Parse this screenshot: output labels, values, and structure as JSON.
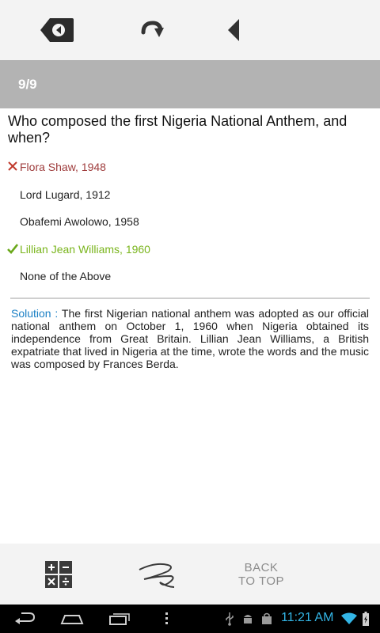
{
  "toolbar": {
    "erase_icon": "backspace-icon",
    "redo_icon": "redo-arrow-icon",
    "back_icon": "triangle-left-icon"
  },
  "progress": {
    "text": "9/9"
  },
  "question": {
    "text": "Who composed the first Nigeria National Anthem, and when?"
  },
  "options": [
    {
      "label": "Flora Shaw, 1948",
      "state": "wrong",
      "color": "#9e3b3b"
    },
    {
      "label": "Lord Lugard, 1912",
      "state": "none"
    },
    {
      "label": "Obafemi Awolowo, 1958",
      "state": "none"
    },
    {
      "label": "Lillian Jean Williams, 1960",
      "state": "correct",
      "color": "#7ab51d"
    },
    {
      "label": "None of the Above",
      "state": "none"
    }
  ],
  "solution": {
    "label": "Solution :",
    "text": "The first Nigerian national anthem was adopted as our official national anthem on October 1, 1960 when Nigeria obtained its independence from Great Britain. Lillian Jean Williams, a British expatriate that lived in Nigeria at the time, wrote the words and the music was composed by Frances Berda.",
    "label_color": "#1a7fc4"
  },
  "bottom_bar": {
    "calc_icon": "calculator-icon",
    "draw_icon": "scribble-icon",
    "back_to_top_line1": "BACK",
    "back_to_top_line2": "TO TOP"
  },
  "system_bar": {
    "time": "11:21 AM",
    "time_color": "#33b5e5",
    "icons": [
      "back-icon",
      "home-icon",
      "recent-apps-icon",
      "menu-icon",
      "usb-icon",
      "android-debug-icon",
      "shopping-bag-icon",
      "wifi-icon",
      "battery-icon"
    ]
  }
}
